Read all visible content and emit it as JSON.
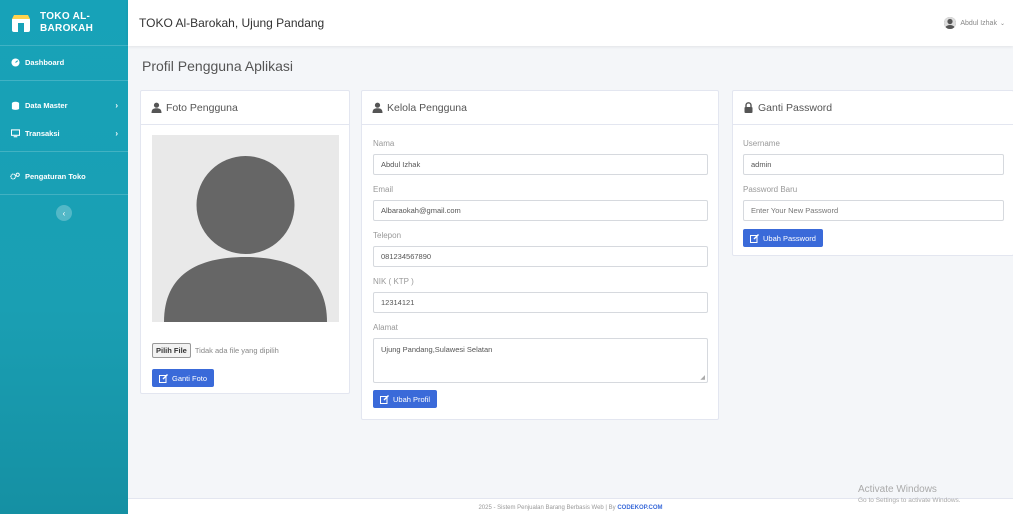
{
  "sidebar": {
    "brand": "TOKO AL-BAROKAH",
    "items": [
      {
        "label": "Dashboard"
      },
      {
        "label": "Data Master"
      },
      {
        "label": "Transaksi"
      },
      {
        "label": "Pengaturan Toko"
      }
    ],
    "collapse_glyph": "‹"
  },
  "topbar": {
    "title": "TOKO Al-Barokah, Ujung Pandang",
    "user_name": "Abdul Izhak"
  },
  "page": {
    "title": "Profil Pengguna Aplikasi"
  },
  "photo_card": {
    "header": "Foto Pengguna",
    "file_button": "Pilih File",
    "file_status": "Tidak ada file yang dipilih",
    "submit_label": "Ganti Foto"
  },
  "profile_card": {
    "header": "Kelola Pengguna",
    "nama_label": "Nama",
    "nama_value": "Abdul Izhak",
    "email_label": "Email",
    "email_value": "Albaraokah@gmail.com",
    "telepon_label": "Telepon",
    "telepon_value": "081234567890",
    "nik_label": "NIK ( KTP )",
    "nik_value": "12314121",
    "alamat_label": "Alamat",
    "alamat_value": "Ujung Pandang,Sulawesi Selatan",
    "submit_label": "Ubah Profil"
  },
  "password_card": {
    "header": "Ganti Password",
    "username_label": "Username",
    "username_value": "admin",
    "new_password_label": "Password Baru",
    "new_password_placeholder": "Enter Your New Password",
    "submit_label": "Ubah Password"
  },
  "footer": {
    "text": "2025 - Sistem Penjualan Barang Berbasis Web | By ",
    "link": "CODEKOP.COM"
  },
  "watermark": {
    "title": "Activate Windows",
    "subtitle": "Go to Settings to activate Windows."
  },
  "colors": {
    "sidebar": "#17a2b8",
    "primary": "#3a6ad9"
  }
}
